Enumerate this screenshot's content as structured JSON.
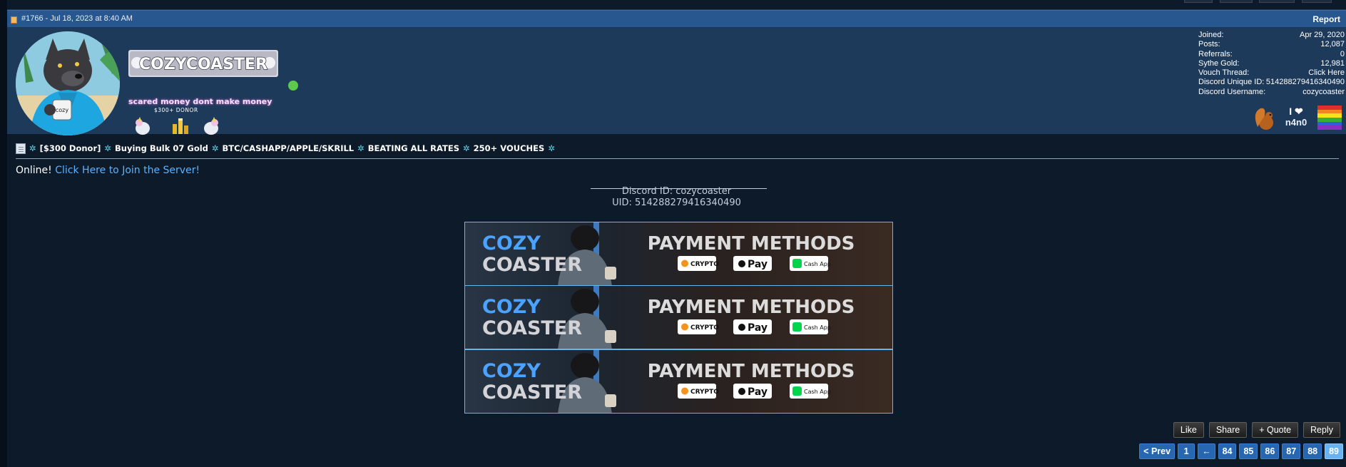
{
  "post": {
    "meta": "#1766 - Jul 18, 2023 at 8:40 AM",
    "report_label": "Report"
  },
  "user": {
    "username": "COZYCOASTER",
    "title": "scared money dont make money",
    "donor_line": "$300+ DONOR",
    "avatar_mug_text": "cozy",
    "online": true
  },
  "stats": [
    {
      "label": "Joined:",
      "value": "Apr 29, 2020"
    },
    {
      "label": "Posts:",
      "value": "12,087"
    },
    {
      "label": "Referrals:",
      "value": "0"
    },
    {
      "label": "Sythe Gold:",
      "value": "12,981"
    },
    {
      "label": "Vouch Thread:",
      "value": "Click Here"
    },
    {
      "label": "Discord Unique ID:",
      "value": "514288279416340490"
    },
    {
      "label": "Discord Username:",
      "value": "cozycoaster"
    }
  ],
  "awards": {
    "heart_award_top": "I ❤",
    "heart_award_bottom": "n4n0"
  },
  "thread": {
    "star": "✲",
    "parts": [
      "[$300 Donor]",
      "Buying Bulk 07 Gold",
      "BTC/CASHAPP/APPLE/SKRILL",
      "BEATING ALL RATES",
      "250+ VOUCHES"
    ]
  },
  "online": {
    "status": "Online!",
    "link": "Click Here to Join the Server!"
  },
  "discord": {
    "line1": "Discord ID: cozycoaster",
    "line2": "UID: 514288279416340490"
  },
  "banner": {
    "brand_top": "COZY",
    "brand_bottom": "COASTER",
    "heading": "PAYMENT METHODS",
    "crypto": "CRYPTO",
    "applepay": "Pay",
    "cashapp": "Cash App",
    "count": 3
  },
  "actions": [
    "Like",
    "Share",
    "+ Quote",
    "Reply"
  ],
  "pager": {
    "prev": "< Prev",
    "first": "1",
    "ellipsis": "←",
    "pages": [
      "84",
      "85",
      "86",
      "87",
      "88",
      "89"
    ],
    "active": "89"
  },
  "colors": {
    "header_bg": "#27578e",
    "profile_bg": "#1e3a5a",
    "body_bg": "#0d1a2a",
    "link": "#5ab2ff",
    "accent_star": "#5fd6e8",
    "online_dot": "#5cc94e"
  }
}
